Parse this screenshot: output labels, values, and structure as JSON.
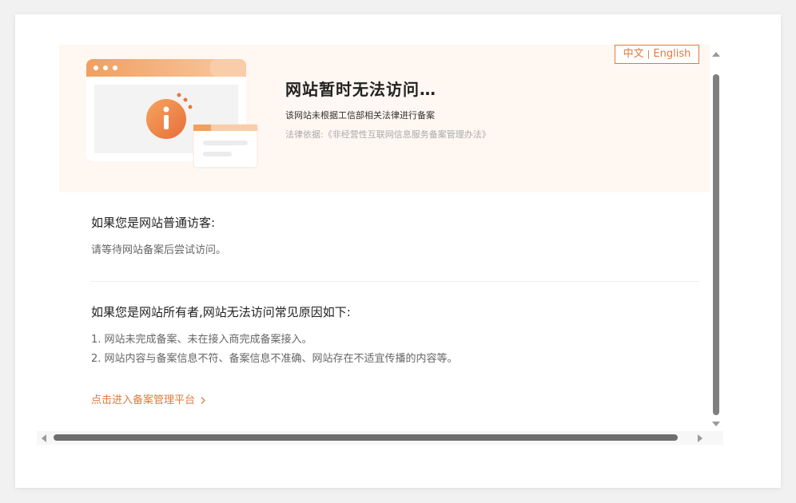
{
  "language_switch": {
    "zh": "中文",
    "separator": "|",
    "en": "English"
  },
  "hero": {
    "title": "网站暂时无法访问…",
    "subtitle": "该网站未根据工信部相关法律进行备案",
    "law_basis": "法律依据:《非经营性互联网信息服务备案管理办法》"
  },
  "visitor": {
    "heading": "如果您是网站普通访客:",
    "text": "请等待网站备案后尝试访问。"
  },
  "owner": {
    "heading": "如果您是网站所有者,网站无法访问常见原因如下:",
    "reasons": [
      "1. 网站未完成备案、未在接入商完成备案接入。",
      "2. 网站内容与备案信息不符、备案信息不准确、网站存在不适宜传播的内容等。"
    ]
  },
  "portal_link": "点击进入备案管理平台",
  "icons": {
    "illustration": "browser-window-info-illustration",
    "link_chevron": "chevron-right-icon",
    "scroll_up": "arrow-up-icon",
    "scroll_down": "arrow-down-icon",
    "scroll_left": "arrow-left-icon",
    "scroll_right": "arrow-right-icon"
  },
  "colors": {
    "accent": "#e07a3f",
    "hero_bg": "#fff7f2",
    "title": "#222222",
    "body_text": "#666666",
    "muted": "#aaaaaa"
  }
}
